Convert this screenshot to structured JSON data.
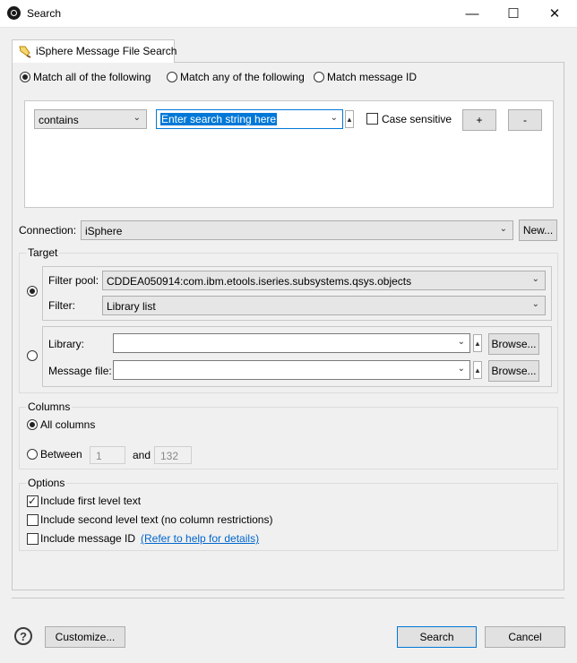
{
  "window": {
    "title": "Search",
    "minimize_glyph": "—",
    "maximize_glyph": "☐",
    "close_glyph": "✕"
  },
  "tab": {
    "label": "iSphere Message File Search",
    "icon": "search-flashlight-icon"
  },
  "match_mode": {
    "options": [
      {
        "label": "Match all of the following",
        "selected": true
      },
      {
        "label": "Match any of the following",
        "selected": false
      },
      {
        "label": "Match message ID",
        "selected": false
      }
    ]
  },
  "criteria": {
    "operator": "contains",
    "search_string": "Enter search string here",
    "case_sensitive_label": "Case sensitive",
    "case_sensitive": false,
    "add_label": "+",
    "remove_label": "-"
  },
  "connection": {
    "label": "Connection:",
    "value": "iSphere",
    "new_button": "New..."
  },
  "target": {
    "legend": "Target",
    "filter_pool_label": "Filter pool:",
    "filter_pool_value": "CDDEA050914:com.ibm.etools.iseries.subsystems.qsys.objects",
    "filter_label": "Filter:",
    "filter_value": "Library list",
    "library_label": "Library:",
    "library_value": "",
    "message_file_label": "Message file:",
    "message_file_value": "",
    "browse_label": "Browse...",
    "filter_selected": true
  },
  "columns": {
    "legend": "Columns",
    "all_label": "All columns",
    "between_label": "Between",
    "and_label": "and",
    "from": "1",
    "to": "132",
    "all_selected": true
  },
  "options": {
    "legend": "Options",
    "items": [
      {
        "label": "Include first level text",
        "checked": true
      },
      {
        "label": "Include second level text (no column restrictions)",
        "checked": false
      },
      {
        "label": "Include message ID",
        "checked": false
      }
    ],
    "help_link": "(Refer to help for details)"
  },
  "footer": {
    "help_glyph": "?",
    "customize": "Customize...",
    "search": "Search",
    "cancel": "Cancel"
  }
}
